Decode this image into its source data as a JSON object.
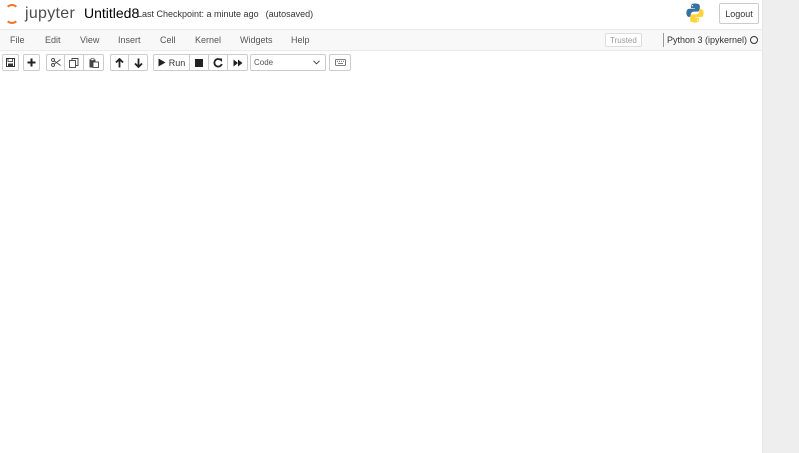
{
  "header": {
    "logo_text": "jupyter",
    "notebook_name": "Untitled8",
    "checkpoint": "Last Checkpoint: a minute ago",
    "autosave": "(autosaved)",
    "logout_label": "Logout"
  },
  "menubar": {
    "items": [
      "File",
      "Edit",
      "View",
      "Insert",
      "Cell",
      "Kernel",
      "Widgets",
      "Help"
    ],
    "trusted_label": "Trusted",
    "kernel_name": "Python 3 (ipykernel)"
  },
  "toolbar": {
    "run_label": "Run",
    "cell_type": "Code"
  },
  "colors": {
    "jupyter_orange": "#f37726",
    "python_blue": "#3671a2",
    "python_yellow": "#ffd43b"
  }
}
